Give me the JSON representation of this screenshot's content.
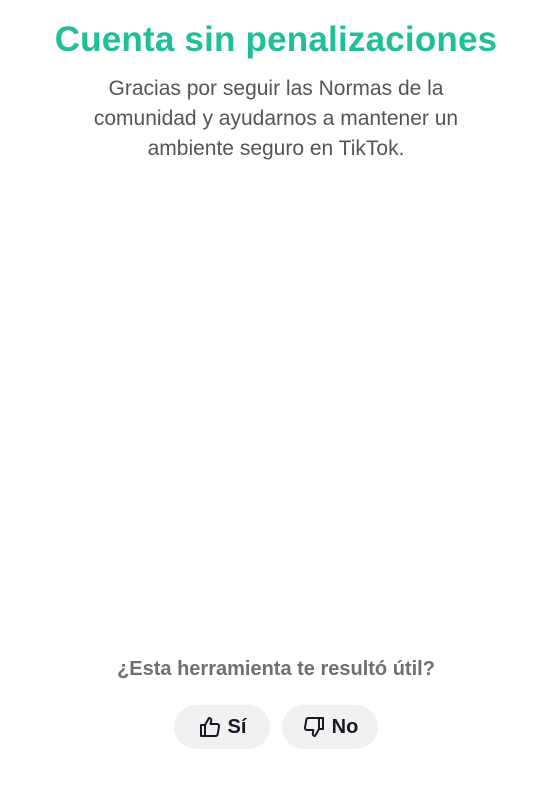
{
  "status": {
    "title": "Cuenta sin penalizaciones",
    "description": "Gracias por seguir las Normas de la comunidad y ayudarnos a mantener un ambiente seguro en TikTok."
  },
  "feedback": {
    "question": "¿Esta herramienta te resultó útil?",
    "yes_label": "Sí",
    "yes_icon": "thumbs-up-icon",
    "no_label": "No",
    "no_icon": "thumbs-down-icon"
  },
  "colors": {
    "accent": "#1fbf99",
    "text_secondary": "#555555",
    "button_bg": "#f1f1f2"
  }
}
